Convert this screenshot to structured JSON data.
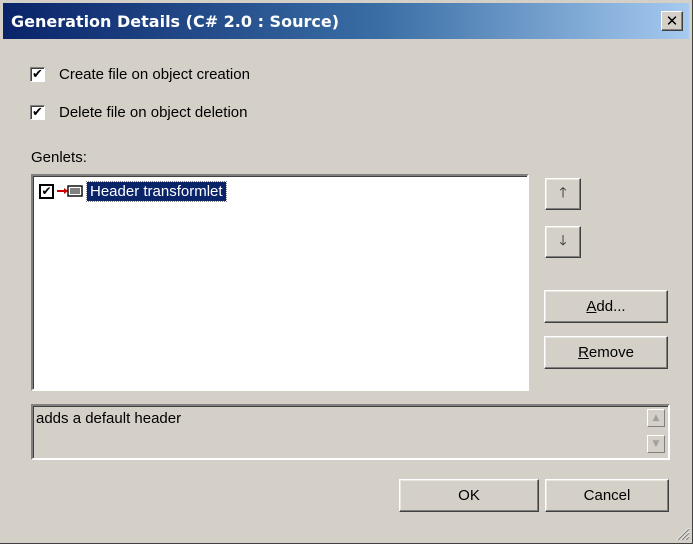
{
  "dialog": {
    "title": "Generation Details (C# 2.0 : Source)",
    "close_glyph": "✕"
  },
  "options": {
    "create_file": {
      "label": "Create file on object creation",
      "checked": true
    },
    "delete_file": {
      "label": "Delete file on object deletion",
      "checked": true
    }
  },
  "genlets": {
    "label": "Genlets:",
    "items": [
      {
        "label": "Header transformlet",
        "checked": true,
        "selected": true,
        "icon": "genlet-icon"
      }
    ]
  },
  "side_buttons": {
    "move_up_glyph": "🡑",
    "move_down_glyph": "🡓",
    "add": {
      "mnemonic": "A",
      "rest": "dd..."
    },
    "remove": {
      "mnemonic": "R",
      "rest": "emove"
    }
  },
  "description": {
    "text": "adds a default header"
  },
  "footer": {
    "ok_label": "OK",
    "cancel_label": "Cancel"
  }
}
